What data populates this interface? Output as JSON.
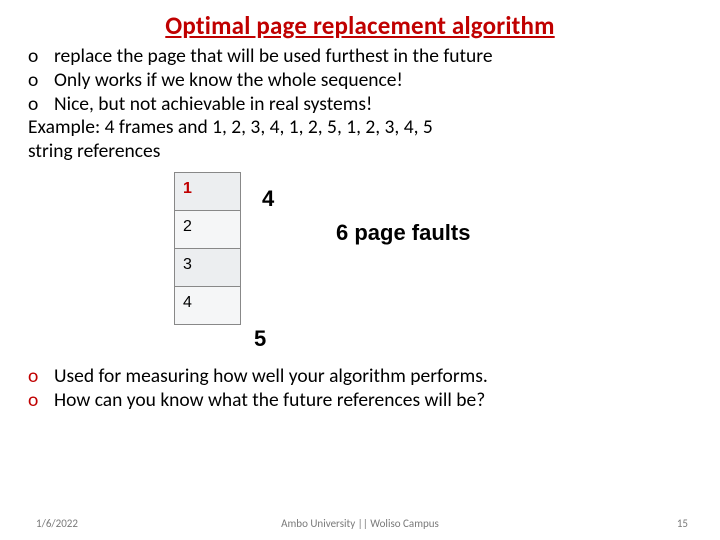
{
  "title": "Optimal page replacement algorithm",
  "bullets_top": [
    "replace the page that will be used furthest in the future",
    " Only works if we know the whole sequence!",
    "Nice, but not achievable in real systems!"
  ],
  "example_line1": "Example: 4 frames and  1, 2, 3, 4, 1, 2, 5, 1, 2, 3, 4, 5",
  "example_line2": "string references",
  "frames": [
    "1",
    "2",
    "3",
    "4"
  ],
  "label_four": "4",
  "label_faults": "6 page faults",
  "label_five": "5",
  "bullets_bottom": [
    "Used for measuring how well your algorithm performs.",
    "How can you know what the future references will be?"
  ],
  "footer": {
    "date": "1/6/2022",
    "center": "Ambo University || Woliso Campus",
    "page": "15"
  }
}
